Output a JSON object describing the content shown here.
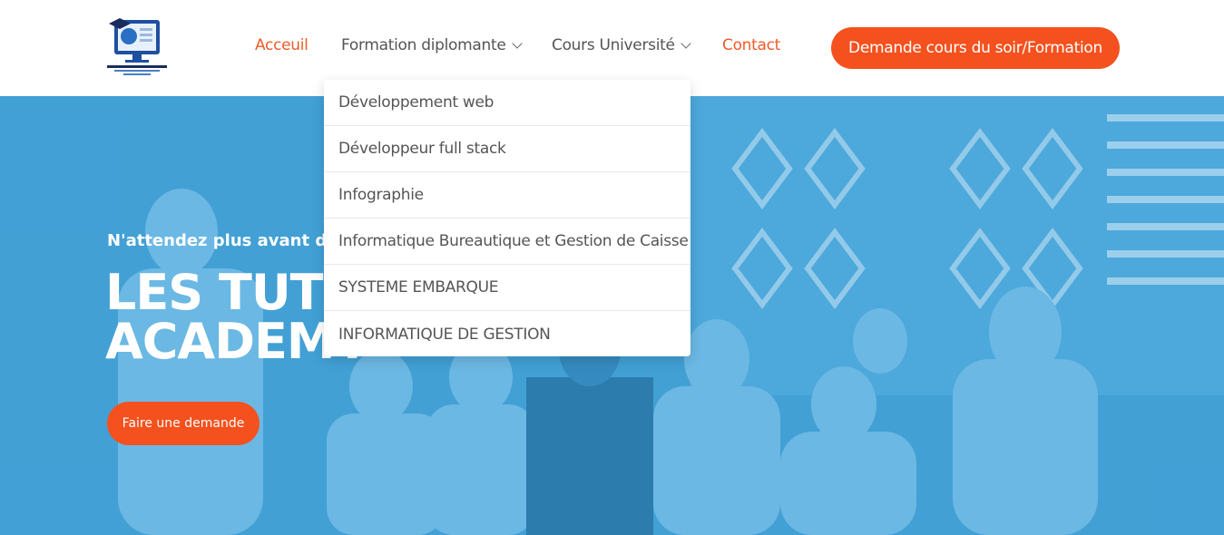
{
  "header": {
    "logo_icon": "school-computer-logo"
  },
  "nav": {
    "items": [
      {
        "label": "Acceuil",
        "active": true
      },
      {
        "label": "Formation diplomante",
        "has_dropdown": true
      },
      {
        "label": "Cours Université",
        "has_dropdown": true
      },
      {
        "label": "Contact",
        "accent": true
      }
    ],
    "cta_label": "Demande cours du soir/Formation"
  },
  "dropdown": {
    "items": [
      "Développement web",
      "Développeur full stack",
      "Infographie",
      "Informatique Bureautique et Gestion de Caisse",
      "SYSTEME EMBARQUE",
      "INFORMATIQUE DE GESTION"
    ]
  },
  "hero": {
    "tagline": "N'attendez plus avant de v",
    "title_line1": "LES TUTO",
    "title_line2": "ACADEMY",
    "button_label": "Faire une demande"
  },
  "colors": {
    "accent": "#f4511e",
    "hero_tint": "#4aa3d6",
    "nav_text": "#555555"
  }
}
